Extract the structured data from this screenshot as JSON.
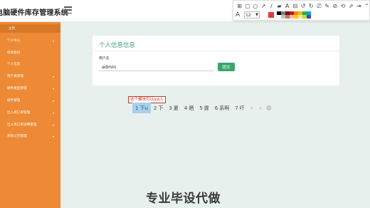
{
  "header": {
    "app_title": "电脑硬件库存管理系统",
    "avatar_text": "👤"
  },
  "toolbar": {
    "tools": [
      "⊞",
      "◻",
      "○",
      "↗",
      "∕",
      "▰",
      "A",
      "⊟",
      "↺",
      "↻",
      "⎚",
      "✎",
      "⊘",
      "⟲",
      "⇗",
      "⇥",
      "⌃"
    ],
    "tool_names": [
      "select-icon",
      "rectangle-icon",
      "ellipse-icon",
      "arrow-icon",
      "line-icon",
      "fill-icon",
      "text-tool-icon",
      "crop-icon",
      "undo-icon",
      "redo-icon",
      "eraser-icon",
      "pen-icon",
      "blur-icon",
      "reset-icon",
      "export-icon",
      "pin-icon",
      "collapse-icon"
    ],
    "font_glyph": "A",
    "font_size": "12",
    "current_color": "#e53935",
    "swatches": [
      "#000000",
      "#7f7f7f",
      "#880015",
      "#b22222",
      "#ff7f27",
      "#e6c000",
      "#22b14c",
      "#00a2e8",
      "#ffffff",
      "#c3c3c3",
      "#b97a57",
      "#ffaec9",
      "#ffc90e",
      "#efe4b0",
      "#b5e61d",
      "#3f48cc"
    ]
  },
  "sidebar": {
    "items": [
      {
        "label": "主页",
        "active": true,
        "has_arrow": false,
        "indent": 12
      },
      {
        "label": "个人中心",
        "active": false,
        "has_arrow": true,
        "indent": 10
      },
      {
        "label": "修改密码",
        "active": false,
        "has_arrow": false,
        "indent": 10
      },
      {
        "label": "个人信息",
        "active": false,
        "has_arrow": false,
        "indent": 10
      },
      {
        "label": "用户类管理",
        "active": false,
        "has_arrow": true,
        "indent": 10
      },
      {
        "label": "硬件类型管理",
        "active": false,
        "has_arrow": true,
        "indent": 10
      },
      {
        "label": "硬件管理",
        "active": false,
        "has_arrow": true,
        "indent": 10
      },
      {
        "label": "出入库订单管理",
        "active": false,
        "has_arrow": true,
        "indent": 10
      },
      {
        "label": "出入库订单详细管理",
        "active": false,
        "has_arrow": true,
        "indent": 10
      },
      {
        "label": "系统公告管理",
        "active": false,
        "has_arrow": true,
        "indent": 10
      }
    ]
  },
  "main": {
    "card_title": "个人信息信息",
    "field_label": "用户名",
    "username_value": "admin",
    "submit_label": "提交"
  },
  "annotation_text": "这个模块可以qia入",
  "pager": {
    "pages": [
      {
        "num": "1",
        "label": "下u",
        "active": true
      },
      {
        "num": "2",
        "label": "下",
        "active": false
      },
      {
        "num": "3",
        "label": "夏",
        "active": false
      },
      {
        "num": "4",
        "label": "晒",
        "active": false
      },
      {
        "num": "5",
        "label": "霆",
        "active": false
      },
      {
        "num": "6",
        "label": "系啊",
        "active": false
      },
      {
        "num": "7",
        "label": "吓",
        "active": false
      }
    ],
    "prev_glyph": "‹",
    "next_glyph": "›",
    "emoji_glyph": "☺"
  },
  "watermark": "专业毕设代做"
}
